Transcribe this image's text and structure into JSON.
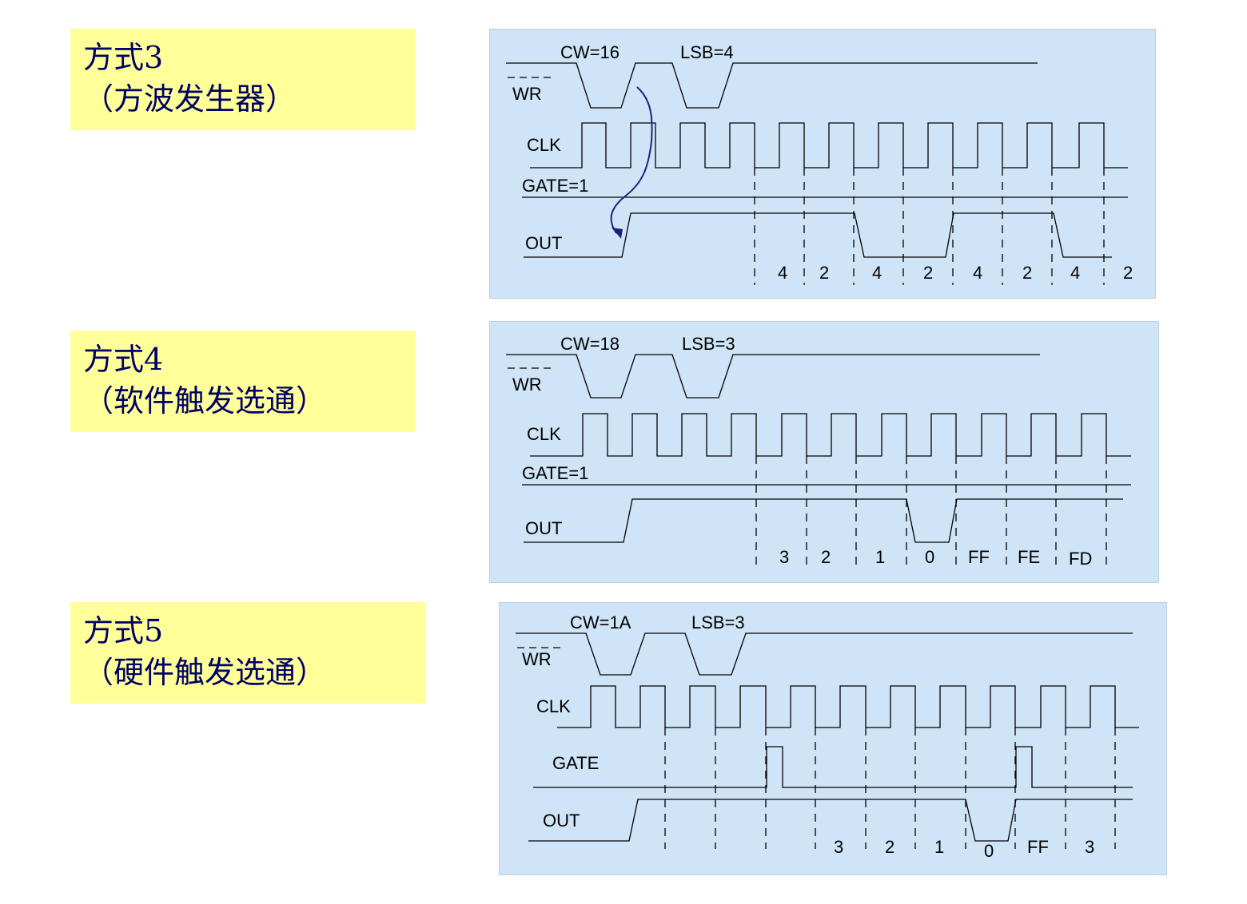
{
  "modes": [
    {
      "title": "方式3",
      "subtitle": "（方波发生器）",
      "diagram": {
        "cw_label": "CW=16",
        "lsb_label": "LSB=4",
        "wr_label": "WR",
        "clk_label": "CLK",
        "gate_label": "GATE=1",
        "out_label": "OUT",
        "counts": [
          "4",
          "2",
          "4",
          "2",
          "4",
          "2",
          "4",
          "2"
        ]
      }
    },
    {
      "title": "方式4",
      "subtitle": "（软件触发选通）",
      "diagram": {
        "cw_label": "CW=18",
        "lsb_label": "LSB=3",
        "wr_label": "WR",
        "clk_label": "CLK",
        "gate_label": "GATE=1",
        "out_label": "OUT",
        "counts": [
          "3",
          "2",
          "1",
          "0",
          "FF",
          "FE",
          "FD"
        ]
      }
    },
    {
      "title": "方式5",
      "subtitle": "（硬件触发选通）",
      "diagram": {
        "cw_label": "CW=1A",
        "lsb_label": "LSB=3",
        "wr_label": "WR",
        "clk_label": "CLK",
        "gate_label": "GATE",
        "out_label": "OUT",
        "counts": [
          "3",
          "2",
          "1",
          "0",
          "FF",
          "3"
        ]
      }
    }
  ],
  "colors": {
    "label_bg": "#ffff99",
    "label_text": "#000066",
    "panel_bg": "#cfe4f7",
    "arrow": "#1a237e"
  }
}
